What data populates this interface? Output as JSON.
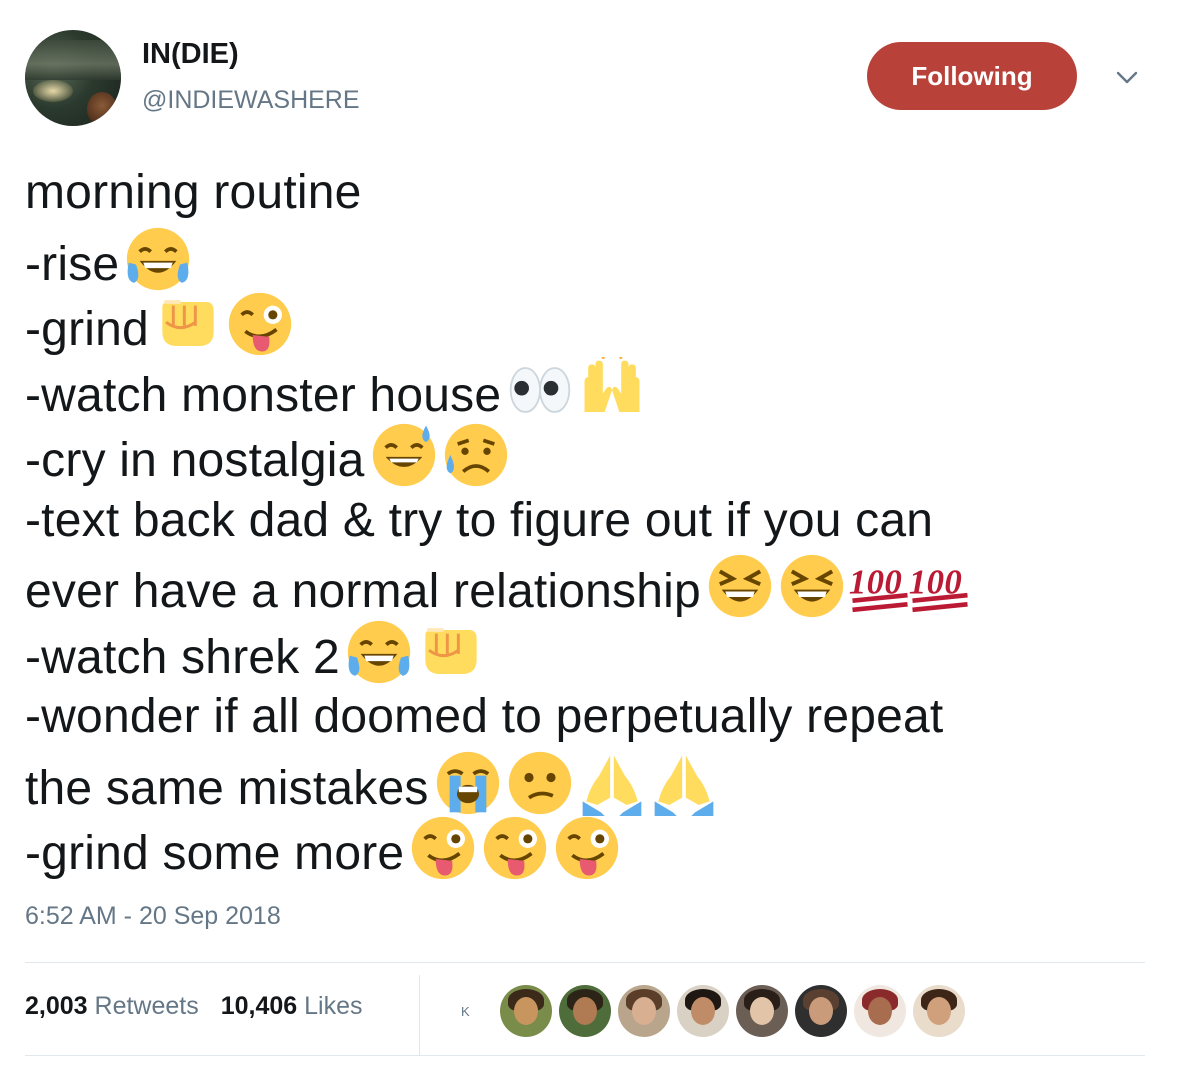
{
  "author": {
    "display_name": "IN(DIE)",
    "handle": "@INDIEWASHERE"
  },
  "follow_button": {
    "label": "Following",
    "color": "#b8423a"
  },
  "tweet": {
    "lines": [
      {
        "text": "morning routine",
        "emojis": []
      },
      {
        "text": "-rise",
        "emojis": [
          "tears-of-joy"
        ]
      },
      {
        "text": "-grind",
        "emojis": [
          "fist",
          "wink-tongue"
        ]
      },
      {
        "text": "-watch monster house",
        "emojis": [
          "eyes",
          "raised-hands"
        ]
      },
      {
        "text": "-cry in nostalgia",
        "emojis": [
          "sweat-smile",
          "sad-sweat"
        ]
      },
      {
        "text": "-text back dad & try to figure out if you can",
        "emojis": []
      },
      {
        "text": "ever have a normal relationship",
        "emojis": [
          "laughing",
          "laughing",
          "hundred",
          "hundred"
        ]
      },
      {
        "text": "-watch shrek 2",
        "emojis": [
          "tears-of-joy",
          "fist"
        ]
      },
      {
        "text": "-wonder if all doomed to perpetually repeat",
        "emojis": []
      },
      {
        "text": "the same mistakes",
        "emojis": [
          "loud-crying",
          "confused",
          "folded-hands",
          "folded-hands"
        ]
      },
      {
        "text": "-grind some more",
        "emojis": [
          "wink-tongue",
          "wink-tongue",
          "wink-tongue"
        ]
      }
    ]
  },
  "timestamp": "6:52 AM - 20 Sep 2018",
  "stats": {
    "retweets_count": "2,003",
    "retweets_label": "Retweets",
    "likes_count": "10,406",
    "likes_label": "Likes"
  },
  "likers": {
    "marker": "K",
    "count": 8
  }
}
